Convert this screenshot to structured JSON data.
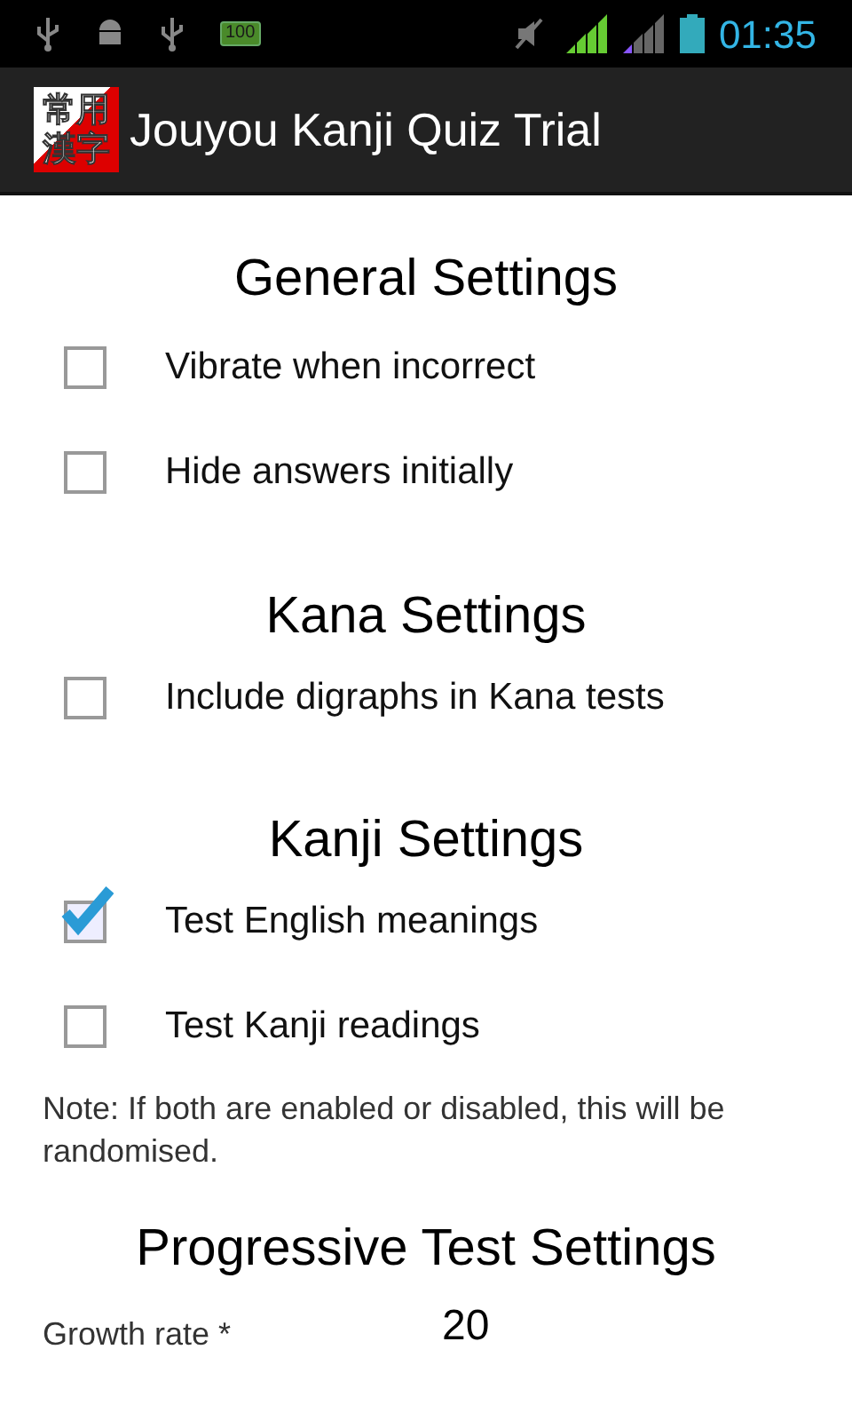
{
  "status_bar": {
    "battery_text": "100",
    "time": "01:35"
  },
  "action_bar": {
    "icon_lines": [
      "常用",
      "漢字"
    ],
    "title": "Jouyou Kanji Quiz Trial"
  },
  "sections": [
    {
      "title": "General Settings",
      "items": [
        {
          "kind": "checkbox",
          "label": "Vibrate when incorrect",
          "checked": false
        },
        {
          "kind": "checkbox",
          "label": "Hide answers initially",
          "checked": false
        }
      ]
    },
    {
      "title": "Kana Settings",
      "items": [
        {
          "kind": "checkbox",
          "label": "Include digraphs in Kana tests",
          "checked": false
        }
      ]
    },
    {
      "title": "Kanji Settings",
      "items": [
        {
          "kind": "checkbox",
          "label": "Test English meanings",
          "checked": true
        },
        {
          "kind": "checkbox",
          "label": "Test Kanji readings",
          "checked": false
        },
        {
          "kind": "note",
          "text": "Note: If both are enabled or disabled, this will be randomised."
        }
      ]
    },
    {
      "title": "Progressive Test Settings",
      "items": [
        {
          "kind": "field",
          "label": "Growth rate *",
          "value": "20"
        }
      ]
    }
  ]
}
